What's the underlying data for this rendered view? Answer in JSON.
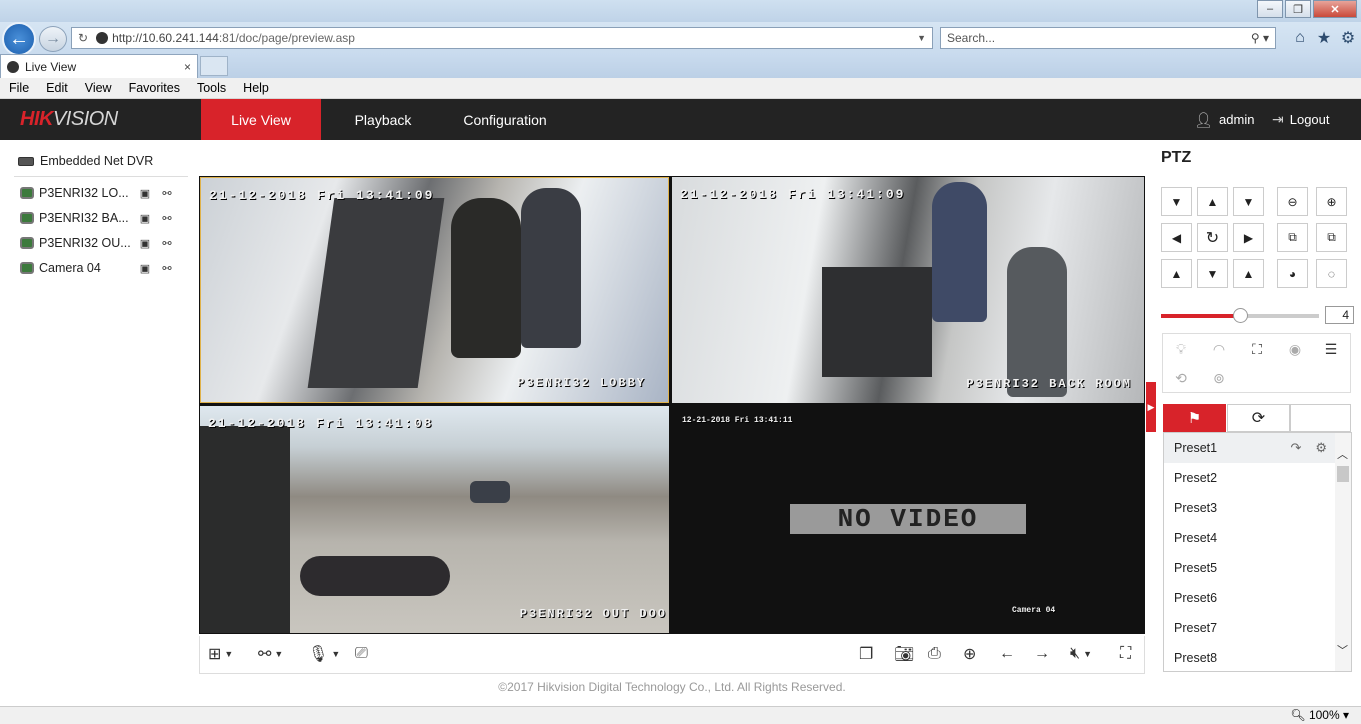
{
  "browser": {
    "url_host": "http://10.60.241.144",
    "url_path": ":81/doc/page/preview.asp",
    "search_placeholder": "Search...",
    "tab_title": "Live View",
    "tab_close": "×",
    "menu": [
      "File",
      "Edit",
      "View",
      "Favorites",
      "Tools",
      "Help"
    ],
    "zoom": "100%"
  },
  "app": {
    "logo_red": "HIK",
    "logo_rest": "VISION",
    "nav": {
      "live": "Live View",
      "playback": "Playback",
      "configuration": "Configuration"
    },
    "user": "admin",
    "logout": "Logout"
  },
  "tree": {
    "root": "Embedded Net DVR",
    "cameras": [
      {
        "label": "P3ENRI32 LO..."
      },
      {
        "label": "P3ENRI32 BA..."
      },
      {
        "label": "P3ENRI32 OU..."
      },
      {
        "label": "Camera 04"
      }
    ]
  },
  "video": {
    "tiles": [
      {
        "timestamp": "21-12-2018 Fri 13:41:09",
        "name": "P3ENRI32 LOBBY"
      },
      {
        "timestamp": "21-12-2018 Fri 13:41:09",
        "name": "P3ENRI32 BACK ROOM"
      },
      {
        "timestamp": "21-12-2018 Fri 13:41:08",
        "name": "P3ENRI32 OUT DOO"
      },
      {
        "timestamp": "12-21-2018 Fri 13:41:11",
        "name": "Camera 04",
        "message": "NO VIDEO"
      }
    ]
  },
  "footer": "©2017 Hikvision Digital Technology Co., Ltd. All Rights Reserved.",
  "ptz": {
    "title": "PTZ",
    "speed": "4",
    "speed_level": 0.5,
    "presets": [
      "Preset1",
      "Preset2",
      "Preset3",
      "Preset4",
      "Preset5",
      "Preset6",
      "Preset7",
      "Preset8"
    ]
  },
  "colors": {
    "accent": "#d8232a",
    "header_bg": "#232323"
  }
}
